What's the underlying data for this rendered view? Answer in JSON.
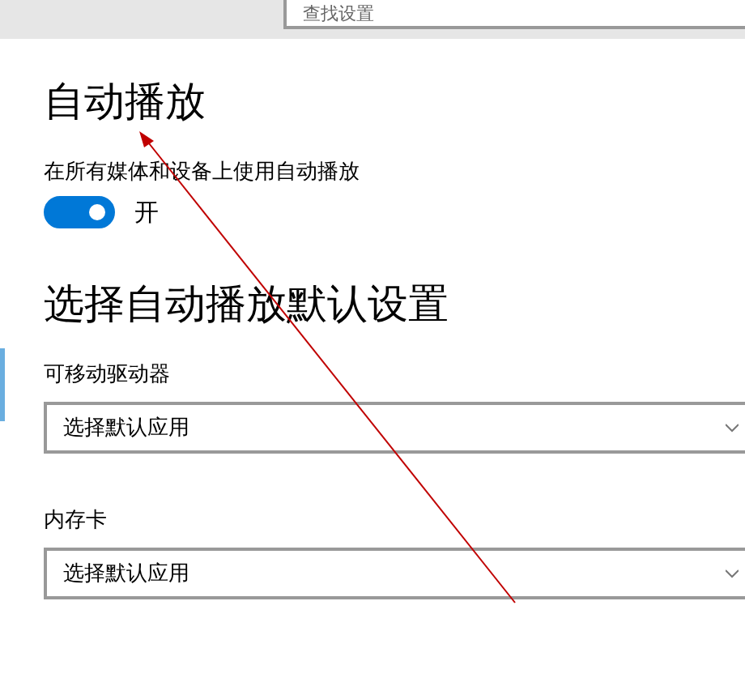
{
  "search": {
    "placeholder": "查找设置"
  },
  "page": {
    "title": "自动播放"
  },
  "autoplay": {
    "label": "在所有媒体和设备上使用自动播放",
    "on": true,
    "state_label": "开"
  },
  "defaults": {
    "heading": "选择自动播放默认设置",
    "dropdowns": [
      {
        "label": "可移动驱动器",
        "value": "选择默认应用"
      },
      {
        "label": "内存卡",
        "value": "选择默认应用"
      }
    ]
  }
}
